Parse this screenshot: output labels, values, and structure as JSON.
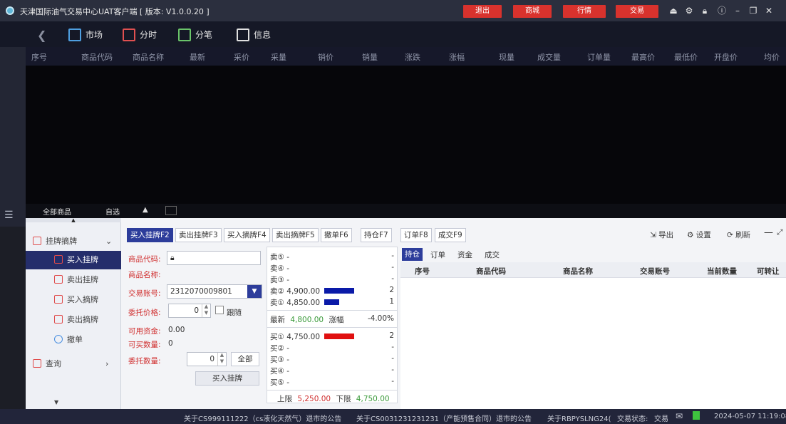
{
  "window": {
    "title": "天津国际油气交易中心UAT客户端 [ 版本: V1.0.0.20 ]",
    "buttons": [
      "退出",
      "商城",
      "行情",
      "交易"
    ],
    "accent": "#d8322d"
  },
  "nav": {
    "tabs": [
      "市场",
      "分时",
      "分笔",
      "信息"
    ]
  },
  "market": {
    "columns": [
      "序号",
      "商品代码",
      "商品名称",
      "最新",
      "采价",
      "采量",
      "销价",
      "销量",
      "涨跌",
      "涨幅",
      "现量",
      "成交量",
      "订单量",
      "最高价",
      "最低价",
      "开盘价",
      "均价"
    ],
    "sheets": [
      "全部商品",
      "自选"
    ]
  },
  "leftnav": {
    "group": "挂牌摘牌",
    "items": [
      "买入挂牌",
      "卖出挂牌",
      "买入摘牌",
      "卖出摘牌",
      "撤单"
    ],
    "query": "查询"
  },
  "toolbar": {
    "tabs": [
      "买入挂牌F2",
      "卖出挂牌F3",
      "买入摘牌F4",
      "卖出摘牌F5",
      "撤单F6",
      "持仓F7",
      "订单F8",
      "成交F9"
    ],
    "right": [
      "导出",
      "设置",
      "刷新"
    ]
  },
  "form": {
    "code_label": "商品代码:",
    "name_label": "商品名称:",
    "account_label": "交易账号:",
    "account_value": "2312070009801",
    "price_label": "委托价格:",
    "price_value": "0",
    "follow_label": "跟随",
    "funds_label": "可用资金:",
    "funds_value": "0.00",
    "buyable_label": "可买数量:",
    "buyable_value": "0",
    "qty_label": "委托数量:",
    "qty_value": "0",
    "all_button": "全部",
    "submit_button": "买入挂牌"
  },
  "book": {
    "sells": [
      {
        "label": "卖⑤",
        "price": "-",
        "qty": "-"
      },
      {
        "label": "卖④",
        "price": "-",
        "qty": "-"
      },
      {
        "label": "卖③",
        "price": "-",
        "qty": "-"
      },
      {
        "label": "卖②",
        "price": "4,900.00",
        "qty": "2"
      },
      {
        "label": "卖①",
        "price": "4,850.00",
        "qty": "1"
      }
    ],
    "last_label": "最新",
    "last_value": "4,800.00",
    "change_label": "涨幅",
    "change_value": "-4.00%",
    "buys": [
      {
        "label": "买①",
        "price": "4,750.00",
        "qty": "2"
      },
      {
        "label": "买②",
        "price": "-",
        "qty": "-"
      },
      {
        "label": "买③",
        "price": "-",
        "qty": "-"
      },
      {
        "label": "买④",
        "price": "-",
        "qty": "-"
      },
      {
        "label": "买⑤",
        "price": "-",
        "qty": "-"
      }
    ],
    "upper_label": "上限",
    "upper_value": "5,250.00",
    "lower_label": "下限",
    "lower_value": "4,750.00",
    "sell_color": "#0a1aa8",
    "buy_color": "#e01010"
  },
  "holdings": {
    "tabs": [
      "持仓",
      "订单",
      "资金",
      "成交"
    ],
    "columns": [
      "序号",
      "商品代码",
      "商品名称",
      "交易账号",
      "当前数量",
      "可转让"
    ]
  },
  "status": {
    "notices": [
      "关于CS999111222（cs液化天然气）退市的公告",
      "关于CS0031231231231（产能预售合同）退市的公告",
      "关于RBPYSLNG24("
    ],
    "trade_label": "交易状态:",
    "trade_value": "交易",
    "datetime": "2024-05-07 11:19:08"
  }
}
